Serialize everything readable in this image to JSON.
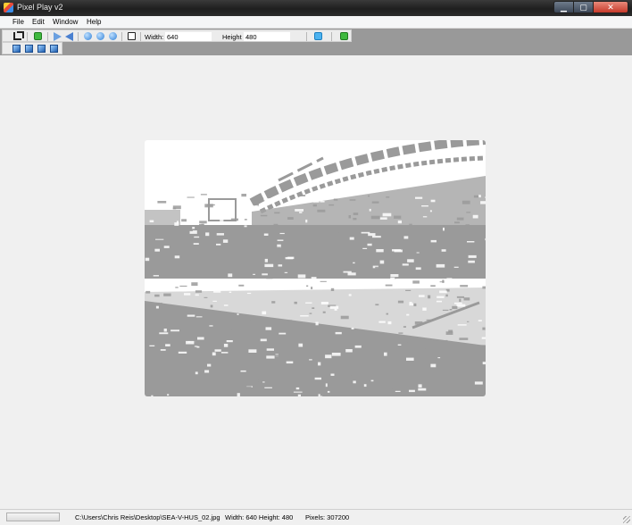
{
  "window": {
    "title": "Pixel Play v2",
    "buttons": {
      "minimize": "▁",
      "maximize": "▢",
      "close": "✕"
    }
  },
  "menu": [
    "File",
    "Edit",
    "Window",
    "Help"
  ],
  "toolbar": {
    "icons": [
      "crop-icon",
      "rotate-green-icon",
      "flip-vertical-icon",
      "flip-horizontal-icon",
      "refresh-icon",
      "rotate-left-icon",
      "rotate-right-icon",
      "border-icon",
      "resize-icon",
      "apply-icon"
    ],
    "width_label": "Width:",
    "width_value": "640",
    "height_label": "Height",
    "height_value": "480",
    "second_row_icons": [
      "image-1-icon",
      "image-2-icon",
      "image-3-icon",
      "image-4-icon"
    ]
  },
  "status": {
    "file_path": "C:\\Users\\Chris Reis\\Desktop\\SEA-V-HUS_02.jpg",
    "dimensions": "Width: 640 Height: 480",
    "pixels": "Pixels: 307200"
  },
  "colors": {
    "image_fg": "#9a9a9a",
    "toolbar_band": "#999999"
  }
}
